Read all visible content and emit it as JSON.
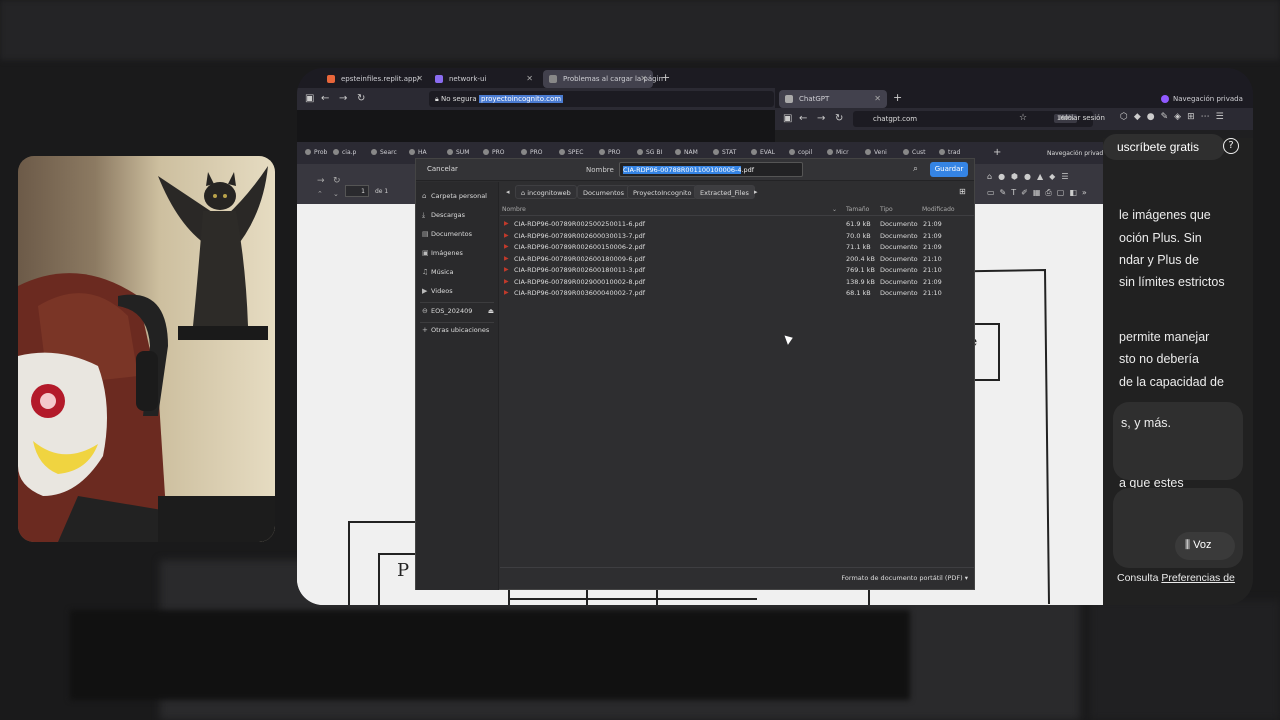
{
  "browser_tabs": [
    {
      "label": "epsteinfiles.replit.app/"
    },
    {
      "label": "network-ui"
    },
    {
      "label": "Problemas al cargar la págin"
    }
  ],
  "second_window": {
    "tab": "ChatGPT",
    "url": "chatgpt.com",
    "zoom": "160%",
    "login": "Iniciar sesión",
    "private": "Navegación privada"
  },
  "urlbar": {
    "security": "No segura",
    "url": "proyectoincognito.com"
  },
  "bookmarks": [
    "Prob",
    "cia.p",
    "Searc",
    "HA",
    "SUM",
    "PRO",
    "PRO",
    "SPEC",
    "PRO",
    "SG BI",
    "NAM",
    "STAT",
    "EVAL",
    "copil",
    "Micr",
    "Veni",
    "Cust",
    "trad"
  ],
  "bookmarks_private": "Navegación privada",
  "pdf_toolbar": {
    "page": "1",
    "of": "de 1"
  },
  "dialog": {
    "cancel": "Cancelar",
    "name_label": "Nombre",
    "filename_selected": "CIA-RDP96-00788R001100100006-4",
    "filename_ext": ".pdf",
    "save": "Guardar",
    "sidebar": [
      {
        "icon": "home-icon",
        "glyph": "⌂",
        "label": "Carpeta personal"
      },
      {
        "icon": "download-icon",
        "glyph": "⤓",
        "label": "Descargas"
      },
      {
        "icon": "document-icon",
        "glyph": "▤",
        "label": "Documentos"
      },
      {
        "icon": "image-icon",
        "glyph": "▣",
        "label": "Imágenes"
      },
      {
        "icon": "music-icon",
        "glyph": "♫",
        "label": "Música"
      },
      {
        "icon": "video-icon",
        "glyph": "▶",
        "label": "Videos"
      }
    ],
    "drive": "EOS_202409",
    "other_locations": "Otras ubicaciones",
    "path": [
      "incognitoweb",
      "Documentos",
      "ProyectoIncognito",
      "Extracted_Files"
    ],
    "columns": {
      "name": "Nombre",
      "size": "Tamaño",
      "type": "Tipo",
      "modified": "Modificado"
    },
    "files": [
      {
        "name": "CIA-RDP96-00789R002500250011-6.pdf",
        "size": "61.9 kB",
        "type": "Documento",
        "time": "21:09"
      },
      {
        "name": "CIA-RDP96-00789R002600030013-7.pdf",
        "size": "70.0 kB",
        "type": "Documento",
        "time": "21:09"
      },
      {
        "name": "CIA-RDP96-00789R002600150006-2.pdf",
        "size": "71.1 kB",
        "type": "Documento",
        "time": "21:09"
      },
      {
        "name": "CIA-RDP96-00789R002600180009-6.pdf",
        "size": "200.4 kB",
        "type": "Documento",
        "time": "21:10"
      },
      {
        "name": "CIA-RDP96-00789R002600180011-3.pdf",
        "size": "769.1 kB",
        "type": "Documento",
        "time": "21:10"
      },
      {
        "name": "CIA-RDP96-00789R002900010002-8.pdf",
        "size": "138.9 kB",
        "type": "Documento",
        "time": "21:09"
      },
      {
        "name": "CIA-RDP96-00789R003600040002-7.pdf",
        "size": "68.1 kB",
        "type": "Documento",
        "time": "21:10"
      }
    ],
    "filter": "Formato de documento portátil (PDF) ▾"
  },
  "chatgpt": {
    "subscribe": "uscríbete gratis",
    "lines": [
      "le imágenes que",
      "oción Plus. Sin",
      "ndar y Plus de",
      "sin límites estrictos",
      "permite manejar",
      "sto no debería",
      "de la capacidad de",
      "s, y más.",
      "a que estes"
    ],
    "voice": "Voz",
    "footer_prefix": "Consulta ",
    "footer_link": "Preferencias de"
  }
}
